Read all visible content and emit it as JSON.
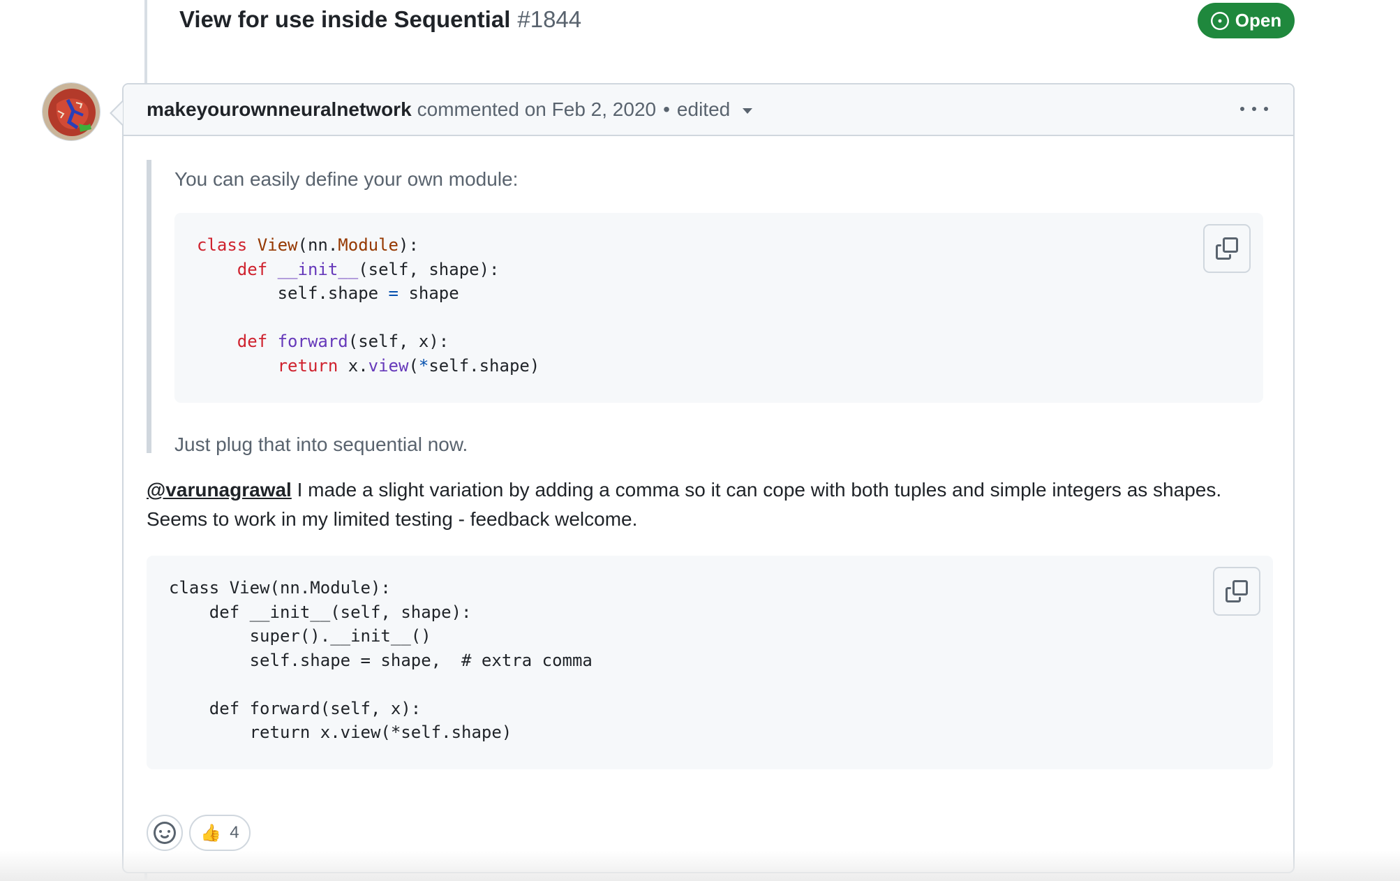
{
  "issue": {
    "title": "View for use inside Sequential",
    "number": "#1844",
    "state": "Open"
  },
  "comment": {
    "author": "makeyourownneuralnetwork",
    "action": "commented on Feb 2, 2020",
    "separator": "•",
    "edited": "edited",
    "quote": {
      "intro": "You can easily define your own module:",
      "outro": "Just plug that into sequential now."
    },
    "body": {
      "mention": "@varunagrawal",
      "line1": " I made a slight variation by adding a comma so it can cope with both tuples and simple integers as shapes.",
      "line2": "Seems to work in my limited testing - feedback welcome."
    },
    "code2": "class View(nn.Module):\n    def __init__(self, shape):\n        super().__init__()\n        self.shape = shape,  # extra comma\n\n    def forward(self, x):\n        return x.view(*self.shape)",
    "reactions": {
      "thumbs_up_count": "4"
    }
  },
  "colors": {
    "open_badge": "#1f883d",
    "border": "#d0d7de",
    "muted_text": "#59636e"
  },
  "icons": [
    "issue-open-icon",
    "caret-down-icon",
    "kebab-icon",
    "copy-icon",
    "smiley-icon",
    "thumbs-up-icon"
  ]
}
